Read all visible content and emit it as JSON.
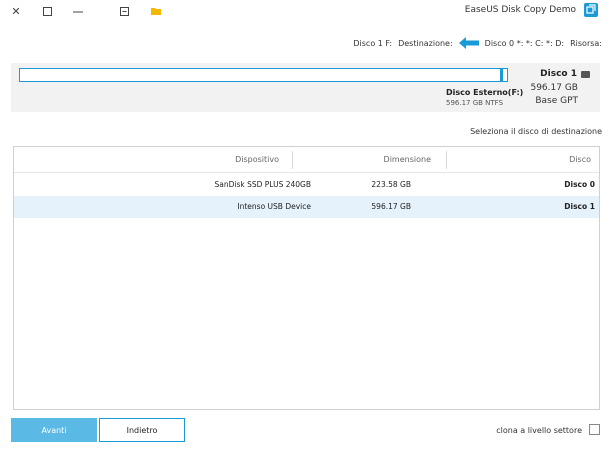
{
  "window": {
    "title": "EaseUS Disk Copy Demo"
  },
  "path": {
    "source_label": "Risorsa:",
    "source_value": "Disco 0 *: *: C: *: D:",
    "dest_label": "Destinazione:",
    "dest_value": "Disco 1 F:"
  },
  "disk_summary": {
    "name": "Disco 1",
    "size": "596.17 GB",
    "type": "Base GPT",
    "partition_label": "Disco Esterno(F:)",
    "partition_detail": "596.17 GB NTFS"
  },
  "prompt": "Seleziona il disco di destinazione",
  "table": {
    "headers": [
      "Disco",
      "Dimensione",
      "Dispositivo"
    ],
    "rows": [
      {
        "disk": "Disco 0",
        "size": "223.58 GB",
        "device": "SanDisk SSD PLUS 240GB",
        "selected": false
      },
      {
        "disk": "Disco 1",
        "size": "596.17 GB",
        "device": "Intenso  USB Device",
        "selected": true
      }
    ]
  },
  "footer": {
    "sector_label": "clona a livello settore",
    "back_label": "Indietro",
    "next_label": "Avanti"
  },
  "colors": {
    "accent": "#1a9ad6",
    "selected_row": "#e5f1fb",
    "next_button": "#5bb9e6"
  }
}
